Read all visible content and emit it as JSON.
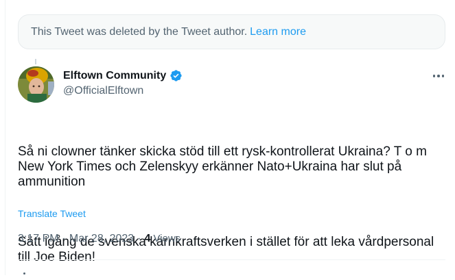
{
  "deleted_notice": {
    "text": "This Tweet was deleted by the Tweet author.",
    "link": "Learn more"
  },
  "tweet": {
    "author_name": "Elftown Community",
    "verified_icon": "verified-badge-icon",
    "handle": "@OfficialElftown",
    "more_icon": "more-options-icon",
    "paragraphs": [
      "Så ni clowner tänker skicka stöd till ett rysk-kontrollerat Ukraina? T o m New York Times och Zelenskyy erkänner Nato+Ukraina har slut på ammunition",
      "Sätt igång de svenska kärnkraftsverken i stället för att leka vårdpersonal till Joe Biden!"
    ],
    "translate_label": "Translate Tweet",
    "time": "3:17 PM",
    "date": "Mar 28, 2023",
    "views_count": "4",
    "views_label": "Views",
    "separator": "·"
  },
  "colors": {
    "accent": "#1d9bf0",
    "secondary_text": "#536471",
    "primary_text": "#0f1419"
  }
}
